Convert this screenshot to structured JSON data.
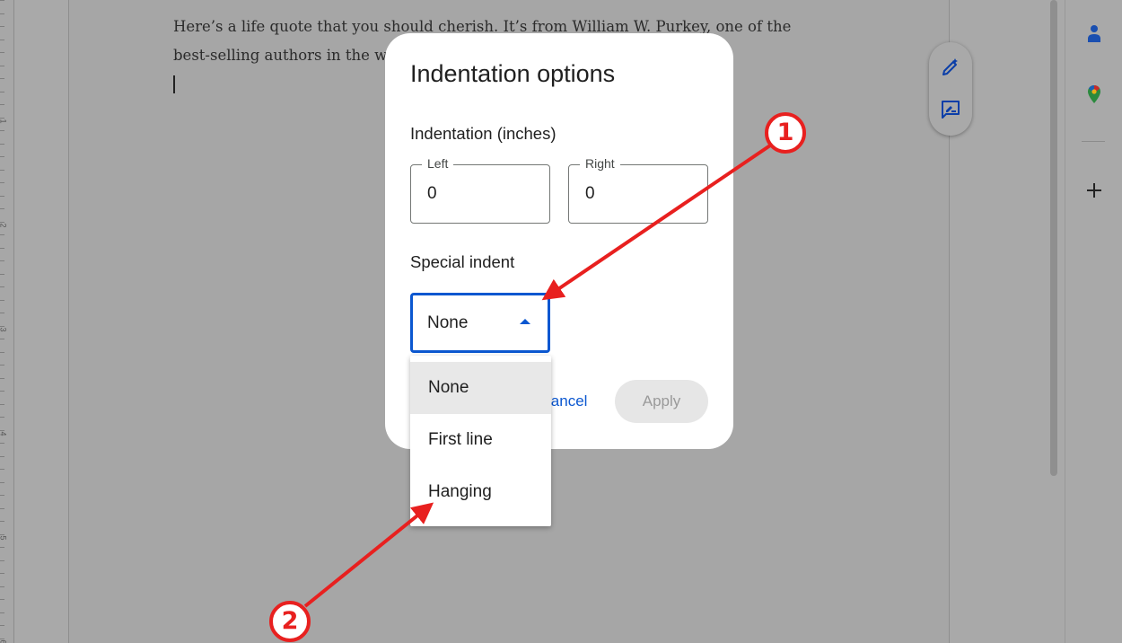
{
  "document": {
    "line1": "Here’s a life quote that you should cherish. It’s from William W. Purkey, one of the",
    "line2": "best-selling authors in the w"
  },
  "ruler": {
    "numbers": [
      "1",
      "2",
      "3",
      "4",
      "5",
      "6"
    ]
  },
  "float_pill": {
    "icons": [
      "pencil-sparkle-icon",
      "comment-add-icon"
    ]
  },
  "side_panel": {
    "icons": [
      "contacts-icon",
      "maps-icon",
      "add-icon"
    ]
  },
  "dialog": {
    "title": "Indentation options",
    "indentation_label": "Indentation (inches)",
    "left_label": "Left",
    "left_value": "0",
    "right_label": "Right",
    "right_value": "0",
    "special_label": "Special indent",
    "special_value": "None",
    "cancel_label": "Cancel",
    "apply_label": "Apply"
  },
  "dropdown": {
    "options": [
      "None",
      "First line",
      "Hanging"
    ],
    "selected": "None"
  },
  "annotations": {
    "badge1": "1",
    "badge2": "2",
    "color": "#e8201f"
  },
  "colors": {
    "accent": "#0b57d0",
    "overlay_bg": "#a9a9a9"
  }
}
